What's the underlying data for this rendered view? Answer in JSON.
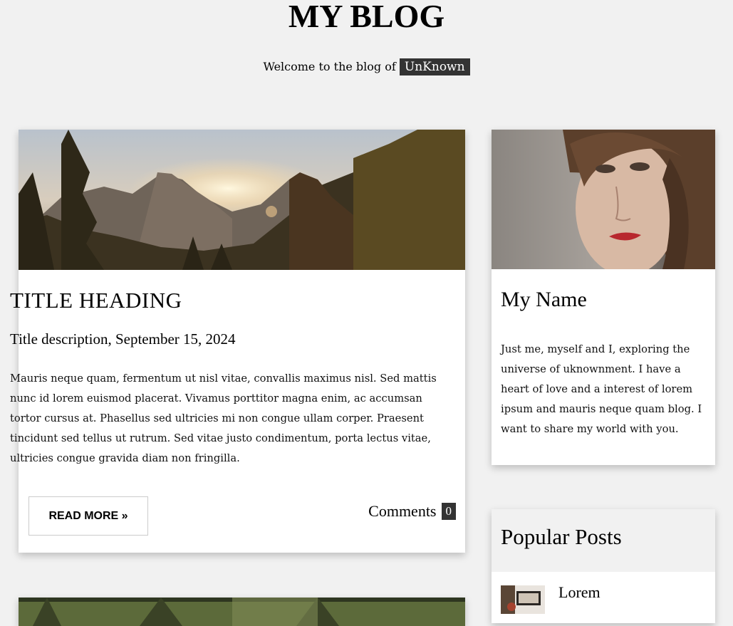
{
  "header": {
    "title": "MY BLOG",
    "welcome_text": "Welcome to the blog of",
    "author_tag": "UnKnown"
  },
  "post": {
    "image_icon": "mountain-sunset-photo",
    "title": "TITLE HEADING",
    "subtitle": "Title description, September 15, 2024",
    "body": "Mauris neque quam, fermentum ut nisl vitae, convallis maximus nisl. Sed mattis nunc id lorem euismod placerat. Vivamus porttitor magna enim, ac accumsan tortor cursus at. Phasellus sed ultricies mi non congue ullam corper. Praesent tincidunt sed tellus ut rutrum. Sed vitae justo condimentum, porta lectus vitae, ultricies congue gravida diam non fringilla.",
    "read_more_label": "READ MORE »",
    "comments_label": "Comments",
    "comments_count": "0"
  },
  "profile": {
    "image_icon": "portrait-photo",
    "name": "My Name",
    "bio": "Just me, myself and I, exploring the universe of uknownment. I have a heart of love and a interest of lorem ipsum and mauris neque quam blog. I want to share my world with you."
  },
  "popular": {
    "title": "Popular Posts",
    "items": [
      {
        "label": "Lorem",
        "image_icon": "workspace-thumbnail"
      }
    ]
  },
  "colors": {
    "background": "#f1f1f1",
    "tag_background": "#333333",
    "card_background": "#ffffff"
  }
}
